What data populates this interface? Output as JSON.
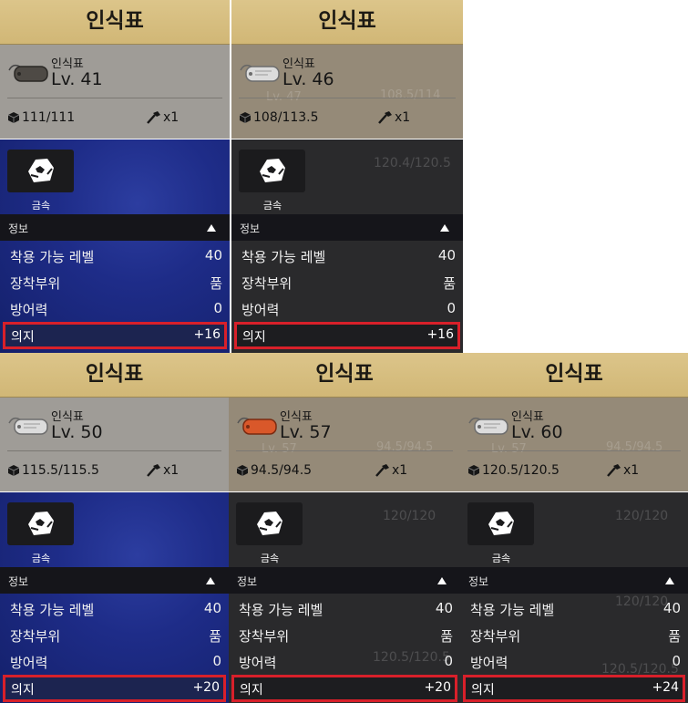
{
  "labels": {
    "title": "인식표",
    "item_name": "인식표",
    "material": "금속",
    "info": "정보",
    "stat_level": "착용 가능 레벨",
    "stat_slot": "장착부위",
    "stat_defense": "방어력",
    "stat_will": "의지"
  },
  "colors": {
    "highlight_border": "#d8202a",
    "title_bar": "#d6be7e",
    "tag_silver": "#dcdcdc",
    "tag_orange": "#d9582a"
  },
  "cards": [
    {
      "theme": "blue",
      "tag_icon": "dog-tag-dark-icon",
      "level_text": "Lv. 41",
      "weight": "111/111",
      "durability": "x1",
      "stats": {
        "level_req": "40",
        "slot": "품",
        "defense": "0",
        "will": "+16"
      },
      "ghost_texts": []
    },
    {
      "theme": "dark",
      "tag_icon": "dog-tag-silver-icon",
      "level_text": "Lv. 46",
      "weight": "108/113.5",
      "durability": "x1",
      "stats": {
        "level_req": "40",
        "slot": "품",
        "defense": "0",
        "will": "+16"
      },
      "ghost_texts": [
        "Lv. 47",
        "108.5/114",
        "120.4/120.5"
      ]
    },
    {
      "theme": "blue",
      "tag_icon": "dog-tag-silver-icon",
      "level_text": "Lv. 50",
      "weight": "115.5/115.5",
      "durability": "x1",
      "stats": {
        "level_req": "40",
        "slot": "품",
        "defense": "0",
        "will": "+20"
      },
      "ghost_texts": []
    },
    {
      "theme": "dark",
      "tag_icon": "dog-tag-orange-icon",
      "level_text": "Lv. 57",
      "weight": "94.5/94.5",
      "durability": "x1",
      "stats": {
        "level_req": "40",
        "slot": "품",
        "defense": "0",
        "will": "+20"
      },
      "ghost_texts": [
        "Lv. 57",
        "94.5/94.5",
        "120/120",
        "120.5/120.5"
      ]
    },
    {
      "theme": "dark",
      "tag_icon": "dog-tag-silver-icon",
      "level_text": "Lv. 60",
      "weight": "120.5/120.5",
      "durability": "x1",
      "stats": {
        "level_req": "40",
        "slot": "품",
        "defense": "0",
        "will": "+24"
      },
      "ghost_texts": [
        "Lv. 57",
        "94.5/94.5",
        "120/120",
        "120/120",
        "120.5/120.5"
      ]
    }
  ]
}
